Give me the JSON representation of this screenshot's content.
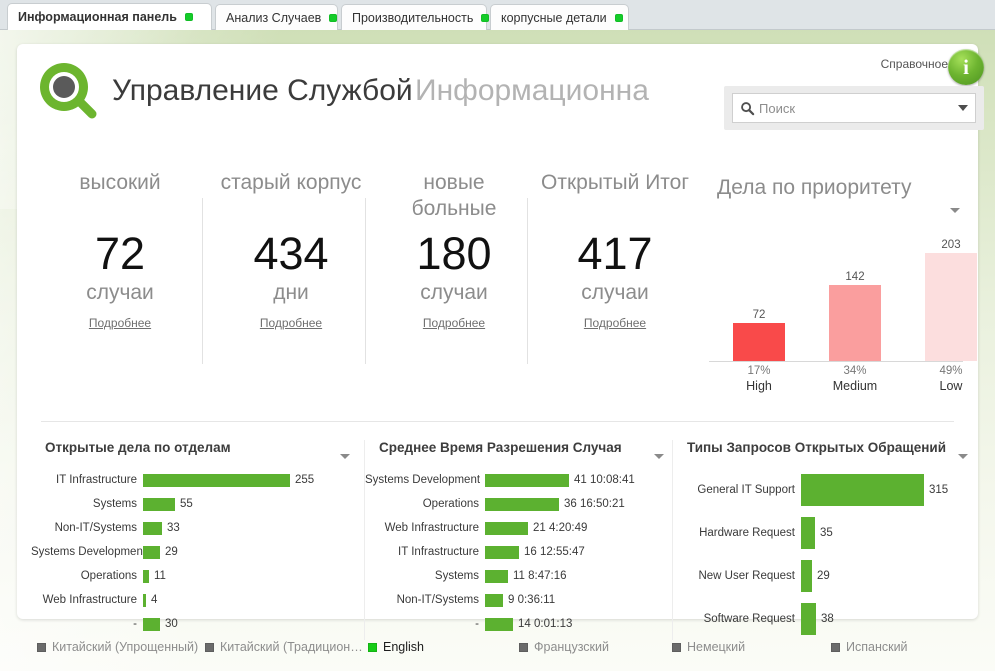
{
  "browser_tabs": [
    {
      "label": "Информационная панель",
      "active": true
    },
    {
      "label": "Анализ Случаев",
      "active": false
    },
    {
      "label": "Производительность",
      "active": false
    },
    {
      "label": "корпусные детали",
      "active": false
    }
  ],
  "header": {
    "logo_icon": "magnifier-logo-icon",
    "title": "Управление Службой",
    "subtitle": "Информационна",
    "help_label": "Справочное",
    "info_icon": "info-icon",
    "info_glyph": "i"
  },
  "search": {
    "icon": "search-icon",
    "placeholder": "Поиск",
    "value": "",
    "dropdown_icon": "chevron-down-icon"
  },
  "kpis": [
    {
      "label": "высокий",
      "value": "72",
      "unit": "случаи",
      "more": "Подробнее"
    },
    {
      "label": "старый корпус",
      "value": "434",
      "unit": "дни",
      "more": "Подробнее"
    },
    {
      "label": "новые больные",
      "value": "180",
      "unit": "случаи",
      "more": "Подробнее"
    },
    {
      "label": "Открытый Итог",
      "value": "417",
      "unit": "случаи",
      "more": "Подробнее"
    }
  ],
  "priority_panel": {
    "title": "Дела по приоритету",
    "menu_icon": "chevron-down-icon"
  },
  "panels": [
    {
      "title": "Открытые дела по отделам",
      "menu_icon": "chevron-down-icon"
    },
    {
      "title": "Среднее Время Разрешения Случая",
      "menu_icon": "chevron-down-icon"
    },
    {
      "title": "Типы Запросов Открытых Обращений",
      "menu_icon": "chevron-down-icon"
    }
  ],
  "languages": [
    {
      "label": "Китайский (Упрощенный)",
      "selected": false
    },
    {
      "label": "Китайский (Традицион…",
      "selected": false
    },
    {
      "label": "English",
      "selected": true
    },
    {
      "label": "Французский",
      "selected": false
    },
    {
      "label": "Немецкий",
      "selected": false
    },
    {
      "label": "Испанский",
      "selected": false
    }
  ],
  "colors": {
    "green": "#5cb130",
    "logo_green": "#6cb52e",
    "red_high": "#f94a4a",
    "red_medium": "#fa9e9e",
    "red_low": "#fcdede",
    "tab_dot": "#14cc29"
  },
  "chart_data": [
    {
      "type": "bar",
      "title": "Дела по приоритету",
      "orientation": "vertical",
      "categories": [
        "High",
        "Medium",
        "Low"
      ],
      "values": [
        72,
        142,
        203
      ],
      "data_labels": [
        "72",
        "142",
        "203"
      ],
      "percent_labels": [
        "17%",
        "34%",
        "49%"
      ],
      "bar_colors": [
        "#f94a4a",
        "#fa9e9e",
        "#fcdede"
      ],
      "xlabel": "",
      "ylabel": "",
      "ylim": [
        0,
        203
      ],
      "grid": false,
      "legend": null
    },
    {
      "type": "bar",
      "title": "Открытые дела по отделам",
      "orientation": "horizontal",
      "categories": [
        "IT Infrastructure",
        "Systems",
        "Non-IT/Systems",
        "Systems Development",
        "Operations",
        "Web Infrastructure",
        "-"
      ],
      "values": [
        255,
        55,
        33,
        29,
        11,
        4,
        30
      ],
      "data_labels": [
        "255",
        "55",
        "33",
        "29",
        "11",
        "4",
        "30"
      ],
      "bar_color": "#5cb130",
      "xlabel": "",
      "ylabel": "",
      "xlim": [
        0,
        255
      ],
      "grid": false,
      "legend": null
    },
    {
      "type": "bar",
      "title": "Среднее Время Разрешения Случая",
      "orientation": "horizontal",
      "categories": [
        "Systems Development",
        "Operations",
        "Web Infrastructure",
        "IT Infrastructure",
        "Systems",
        "Non-IT/Systems",
        "-"
      ],
      "values": [
        41.42,
        36.7,
        21.18,
        16.54,
        11.37,
        9.03,
        14.0
      ],
      "data_labels": [
        "41 10:08:41",
        "36 16:50:21",
        "21 4:20:49",
        "16 12:55:47",
        "11 8:47:16",
        "9 0:36:11",
        "14 0:01:13"
      ],
      "bar_color": "#5cb130",
      "xlabel": "",
      "ylabel": "",
      "xlim": [
        0,
        41.42
      ],
      "grid": false,
      "legend": null
    },
    {
      "type": "bar",
      "title": "Типы Запросов Открытых Обращений",
      "orientation": "horizontal",
      "categories": [
        "General IT Support",
        "Hardware Request",
        "New User Request",
        "Software Request"
      ],
      "values": [
        315,
        35,
        29,
        38
      ],
      "data_labels": [
        "315",
        "35",
        "29",
        "38"
      ],
      "bar_color": "#5cb130",
      "xlabel": "",
      "ylabel": "",
      "xlim": [
        0,
        315
      ],
      "grid": false,
      "legend": null
    }
  ]
}
